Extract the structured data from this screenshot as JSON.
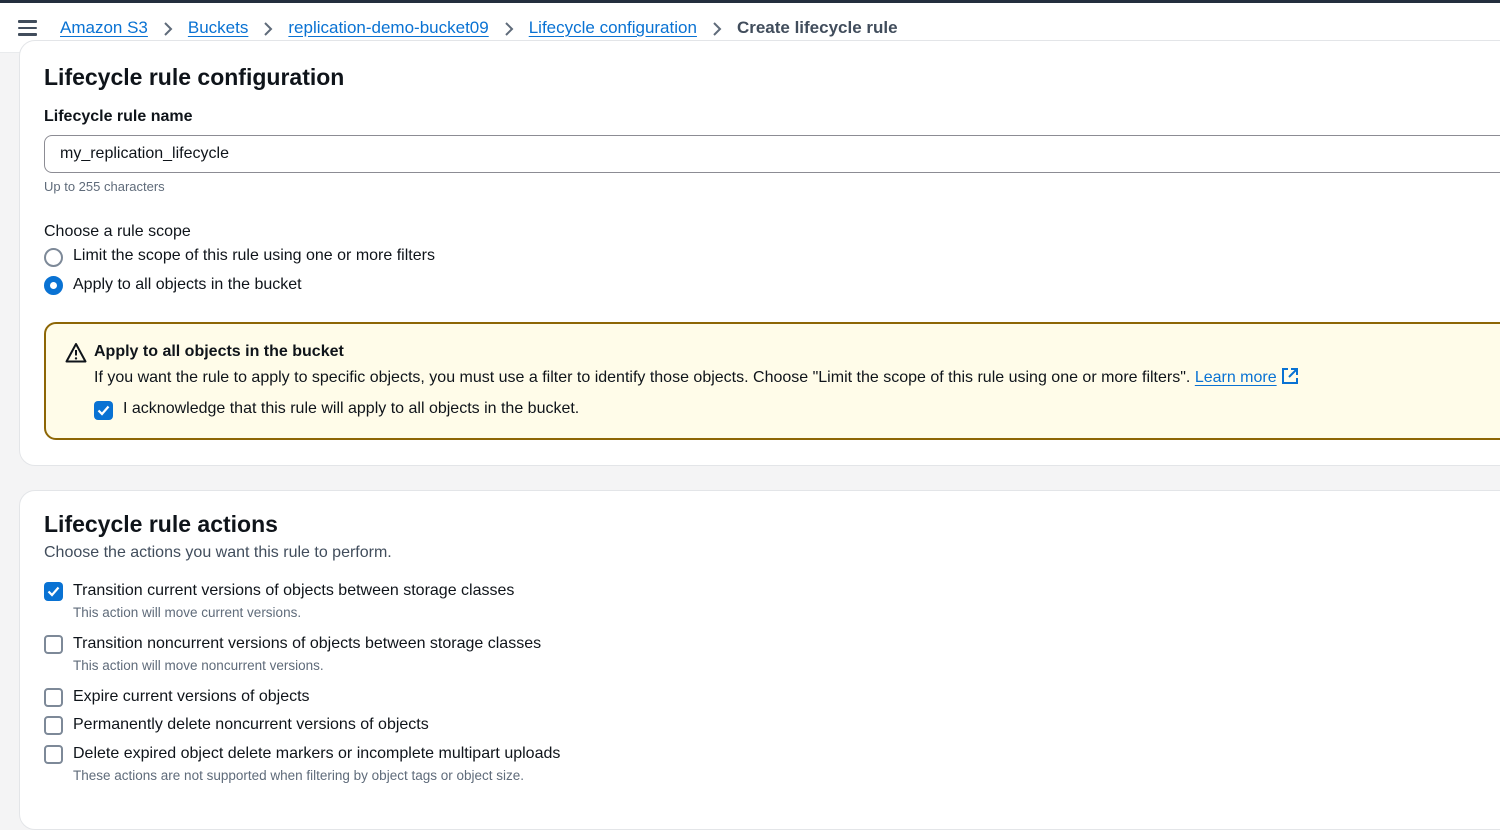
{
  "header": {
    "breadcrumbs": [
      {
        "label": "Amazon S3"
      },
      {
        "label": "Buckets"
      },
      {
        "label": "replication-demo-bucket09"
      },
      {
        "label": "Lifecycle configuration"
      }
    ],
    "current": "Create lifecycle rule"
  },
  "config_panel": {
    "title": "Lifecycle rule configuration",
    "name_label": "Lifecycle rule name",
    "name_value": "my_replication_lifecycle",
    "name_hint": "Up to 255 characters",
    "scope_label": "Choose a rule scope",
    "scope_options": [
      {
        "label": "Limit the scope of this rule using one or more filters",
        "selected": false
      },
      {
        "label": "Apply to all objects in the bucket",
        "selected": true
      }
    ],
    "alert": {
      "icon": "warning-icon",
      "title": "Apply to all objects in the bucket",
      "body": "If you want the rule to apply to specific objects, you must use a filter to identify those objects. Choose \"Limit the scope of this rule using one or more filters\".",
      "link": "Learn more",
      "ack_label": "I acknowledge that this rule will apply to all objects in the bucket.",
      "ack_checked": true
    }
  },
  "actions_panel": {
    "title": "Lifecycle rule actions",
    "description": "Choose the actions you want this rule to perform.",
    "actions": [
      {
        "label": "Transition current versions of objects between storage classes",
        "sub": "This action will move current versions.",
        "checked": true
      },
      {
        "label": "Transition noncurrent versions of objects between storage classes",
        "sub": "This action will move noncurrent versions.",
        "checked": false
      },
      {
        "label": "Expire current versions of objects",
        "sub": "",
        "checked": false
      },
      {
        "label": "Permanently delete noncurrent versions of objects",
        "sub": "",
        "checked": false
      },
      {
        "label": "Delete expired object delete markers or incomplete multipart uploads",
        "sub": "These actions are not supported when filtering by object tags or object size.",
        "checked": false
      }
    ]
  },
  "colors": {
    "link": "#0972d3",
    "alert_border": "#8d6605",
    "alert_bg": "#fffce9",
    "check": "#0972d3"
  }
}
